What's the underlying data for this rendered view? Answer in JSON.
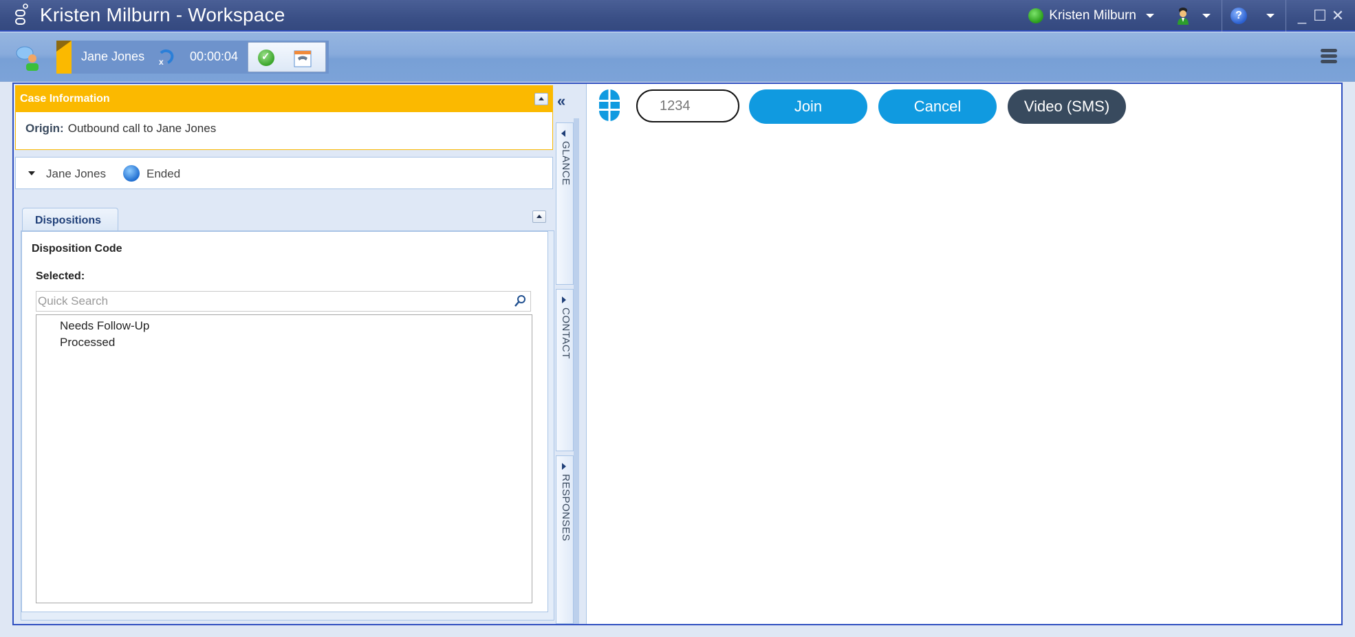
{
  "window": {
    "title": "Kristen Milburn - Workspace",
    "user_name": "Kristen Milburn",
    "user_status_color": "#2ea11f",
    "controls": {
      "minimize": "_",
      "maximize": "☐",
      "close": "✕"
    },
    "help_glyph": "?"
  },
  "toolbar": {
    "interaction": {
      "contact_name": "Jane Jones",
      "timer": "00:00:04",
      "case_color": "#fbb900"
    }
  },
  "case_info": {
    "title": "Case Information",
    "origin_label": "Origin:",
    "origin_value": "Outbound call to Jane Jones"
  },
  "party": {
    "name": "Jane Jones",
    "status": "Ended"
  },
  "dispositions": {
    "tab_label": "Dispositions",
    "section_title": "Disposition Code",
    "selected_label": "Selected:",
    "search_placeholder": "Quick Search",
    "items": [
      "Needs Follow-Up",
      "Processed"
    ]
  },
  "side_tabs": {
    "collapse_glyph": "«",
    "tabs": [
      {
        "label": "GLANCE",
        "expanded": true
      },
      {
        "label": "CONTACT",
        "expanded": false
      },
      {
        "label": "RESPONSES",
        "expanded": false
      }
    ]
  },
  "video_panel": {
    "code_placeholder": "1234",
    "join_label": "Join",
    "cancel_label": "Cancel",
    "video_sms_label": "Video (SMS)",
    "accent_color": "#109ae0",
    "dark_color": "#384a5e"
  }
}
